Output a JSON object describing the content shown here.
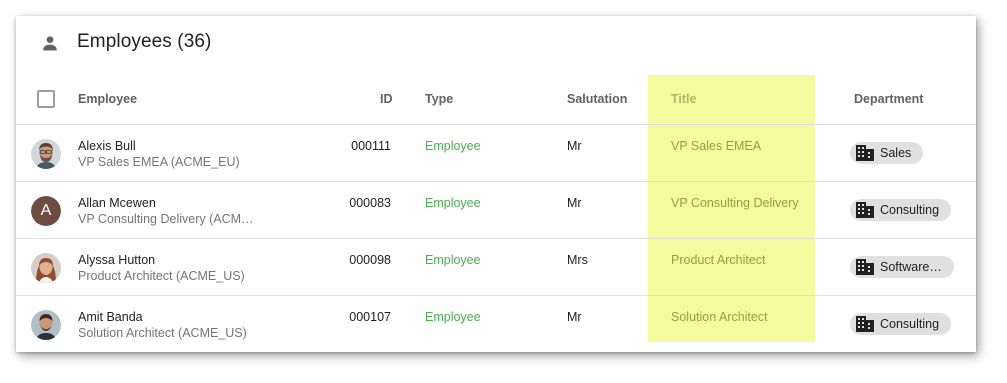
{
  "card": {
    "title": "Employees (36)",
    "title_icon": "person-icon",
    "highlight_color": "#f7f99f"
  },
  "table": {
    "columns": {
      "employee": "Employee",
      "id": "ID",
      "type": "Type",
      "salutation": "Salutation",
      "title": "Title",
      "department": "Department"
    },
    "rows": [
      {
        "avatar": "photo-man-beard",
        "name": "Alexis Bull",
        "subtitle": "VP Sales EMEA (ACME_EU)",
        "id": "000111",
        "type": "Employee",
        "salutation": "Mr",
        "title": "VP Sales EMEA",
        "department": "Sales"
      },
      {
        "avatar_letter": "A",
        "name": "Allan Mcewen",
        "subtitle": "VP Consulting Delivery (ACME…",
        "id": "000083",
        "type": "Employee",
        "salutation": "Mr",
        "title": "VP Consulting Delivery",
        "department": "Consulting"
      },
      {
        "avatar": "photo-woman",
        "name": "Alyssa Hutton",
        "subtitle": "Product Architect (ACME_US)",
        "id": "000098",
        "type": "Employee",
        "salutation": "Mrs",
        "title": "Product Architect",
        "department": "Software …"
      },
      {
        "avatar": "photo-man",
        "name": "Amit Banda",
        "subtitle": "Solution Architect (ACME_US)",
        "id": "000107",
        "type": "Employee",
        "salutation": "Mr",
        "title": "Solution Architect",
        "department": "Consulting"
      }
    ]
  },
  "colors": {
    "type_green": "#4caf50",
    "title_olive": "#9c9c3e",
    "chip_bg": "#e0e0e0"
  }
}
